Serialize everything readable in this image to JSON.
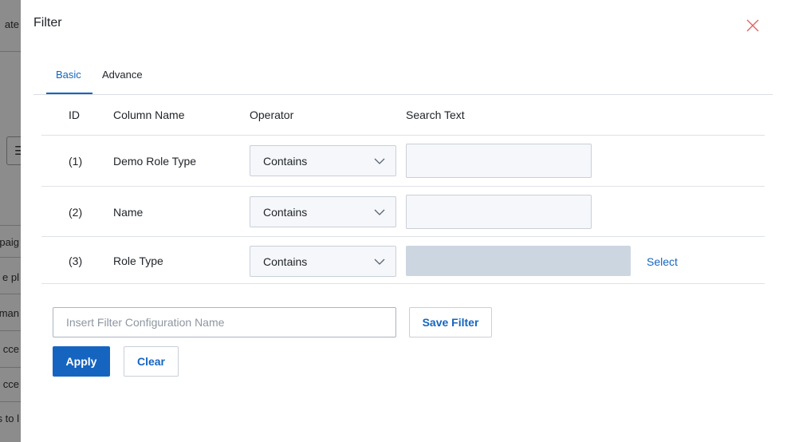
{
  "background_page": {
    "fragments": [
      "ate",
      "paig",
      "e pl",
      "man",
      "cce",
      "cce",
      "s to l"
    ],
    "button_glyph": "☰"
  },
  "modal": {
    "title": "Filter",
    "close_icon": "close-icon",
    "tabs": [
      {
        "label": "Basic",
        "active": true
      },
      {
        "label": "Advance",
        "active": false
      }
    ],
    "table": {
      "headers": {
        "id": "ID",
        "column_name": "Column Name",
        "operator": "Operator",
        "search_text": "Search Text"
      },
      "rows": [
        {
          "id": "(1)",
          "column_name": "Demo Role Type",
          "operator": "Contains",
          "search_text": ""
        },
        {
          "id": "(2)",
          "column_name": "Name",
          "operator": "Contains",
          "search_text": ""
        },
        {
          "id": "(3)",
          "column_name": "Role Type",
          "operator": "Contains",
          "search_text": "",
          "select_label": "Select"
        }
      ]
    },
    "config": {
      "placeholder": "Insert Filter Configuration Name",
      "value": "",
      "save_label": "Save Filter"
    },
    "actions": {
      "apply_label": "Apply",
      "clear_label": "Clear"
    },
    "colors": {
      "accent": "#1565c0",
      "disabled_input": "#ccd6e0",
      "input_bg": "#f5f7fa",
      "close_icon": "#e06666"
    }
  }
}
